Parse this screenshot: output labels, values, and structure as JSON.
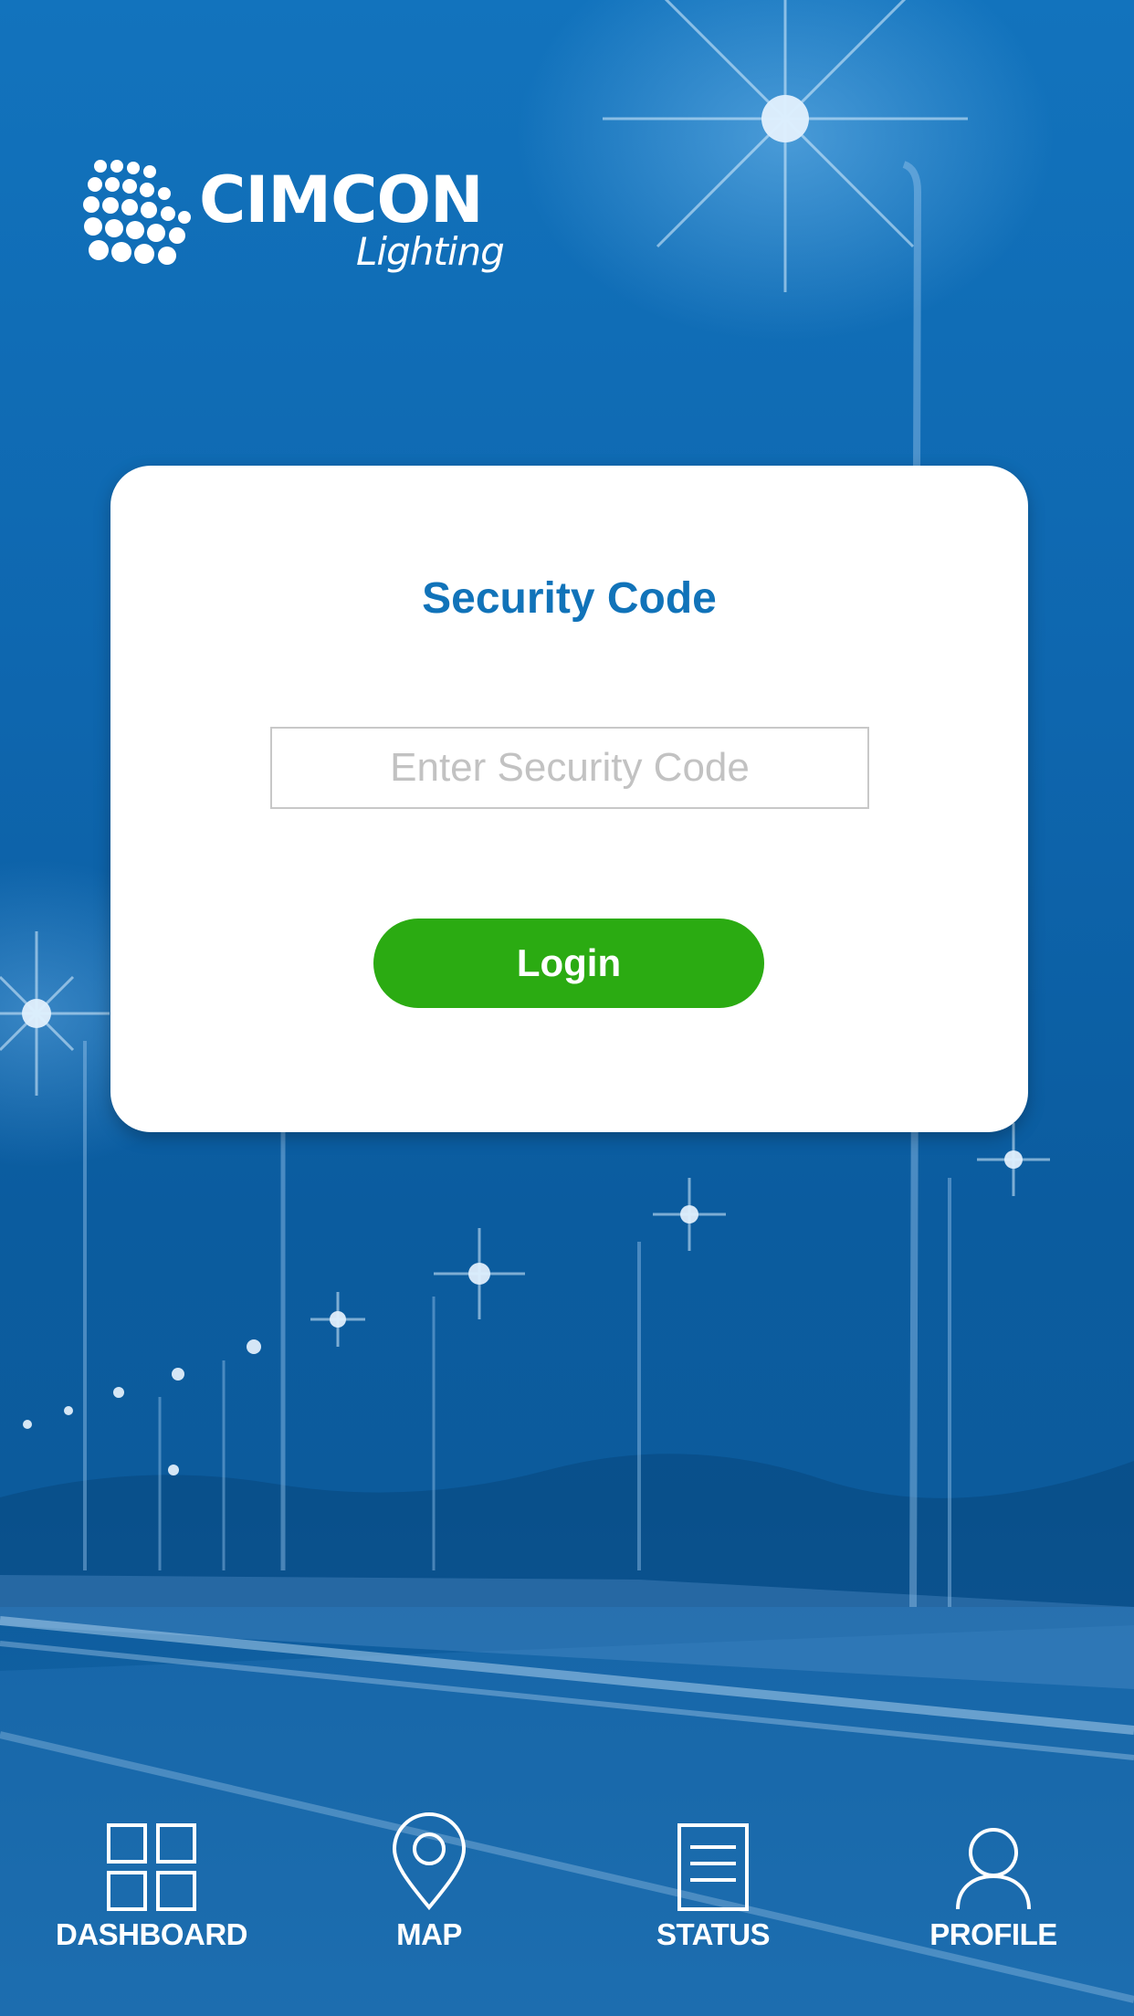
{
  "brand": {
    "name": "CIMCON",
    "subtitle": "Lighting"
  },
  "login_card": {
    "title": "Security Code",
    "code_input": {
      "placeholder": "Enter Security Code",
      "value": ""
    },
    "login_label": "Login"
  },
  "tabbar": {
    "items": [
      {
        "label": "DASHBOARD",
        "icon": "dashboard-grid-icon"
      },
      {
        "label": "MAP",
        "icon": "map-pin-icon"
      },
      {
        "label": "STATUS",
        "icon": "document-list-icon"
      },
      {
        "label": "PROFILE",
        "icon": "person-icon"
      }
    ]
  },
  "colors": {
    "background": "#0d63a8",
    "title": "#1173b9",
    "login_button": "#2bab12",
    "card": "#ffffff"
  }
}
